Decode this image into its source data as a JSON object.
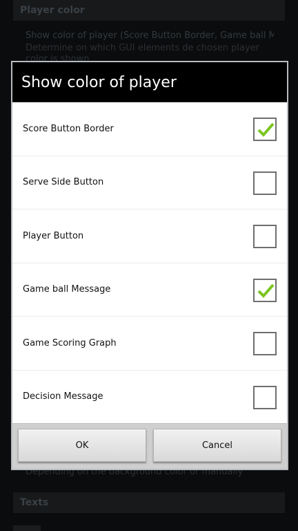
{
  "background": {
    "section_header": "Player color",
    "pref_title": "Show color of player (Score Button Border, Game ball Mess..",
    "pref_summary": "Determine on which GUI elements de chosen player color is shown",
    "hidden_summary": "Depending on the background color or manually",
    "texts_header": "Texts"
  },
  "dialog": {
    "title": "Show color of player",
    "options": [
      {
        "label": "Score Button Border",
        "checked": true
      },
      {
        "label": "Serve Side Button",
        "checked": false
      },
      {
        "label": "Player Button",
        "checked": false
      },
      {
        "label": "Game ball Message",
        "checked": true
      },
      {
        "label": "Game Scoring Graph",
        "checked": false
      },
      {
        "label": "Decision Message",
        "checked": false
      }
    ],
    "ok_label": "OK",
    "cancel_label": "Cancel"
  },
  "colors": {
    "check_green": "#7cc521",
    "title_bar": "#000000",
    "button_bar": "#cfcfcf"
  },
  "icons": {
    "check": "checkmark-icon"
  }
}
